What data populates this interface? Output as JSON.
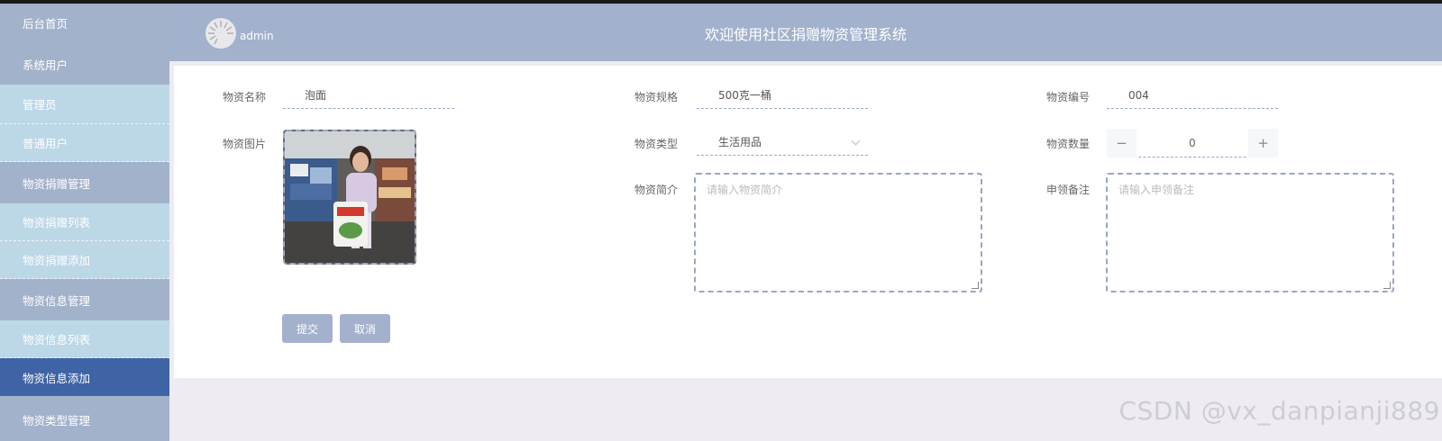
{
  "header": {
    "username": "admin",
    "title": "欢迎使用社区捐赠物资管理系统"
  },
  "sidebar": {
    "items": [
      {
        "label": "后台首页"
      },
      {
        "label": "系统用户"
      },
      {
        "label": "管理员"
      },
      {
        "label": "普通用户"
      },
      {
        "label": "物资捐赠管理"
      },
      {
        "label": "物资捐赠列表"
      },
      {
        "label": "物资捐赠添加"
      },
      {
        "label": "物资信息管理"
      },
      {
        "label": "物资信息列表"
      },
      {
        "label": "物资信息添加"
      },
      {
        "label": "物资类型管理"
      }
    ],
    "active_index": 9
  },
  "form": {
    "name_label": "物资名称",
    "name_value": "泡面",
    "spec_label": "物资规格",
    "spec_value": "500克一桶",
    "code_label": "物资编号",
    "code_value": "004",
    "image_label": "物资图片",
    "type_label": "物资类型",
    "type_value": "生活用品",
    "qty_label": "物资数量",
    "qty_value": "0",
    "qty_minus": "−",
    "qty_plus": "+",
    "intro_label": "物资简介",
    "intro_placeholder": "请输入物资简介",
    "remark_label": "申领备注",
    "remark_placeholder": "请输入申领备注",
    "submit_label": "提交",
    "cancel_label": "取消"
  },
  "watermark": "CSDN @vx_danpianji889",
  "colors": {
    "sidebar": "#a3b2cb",
    "submenu": "#bcd7e6",
    "active": "#3f64a6",
    "header": "#a2b1cc",
    "button": "#a3b1cc"
  }
}
